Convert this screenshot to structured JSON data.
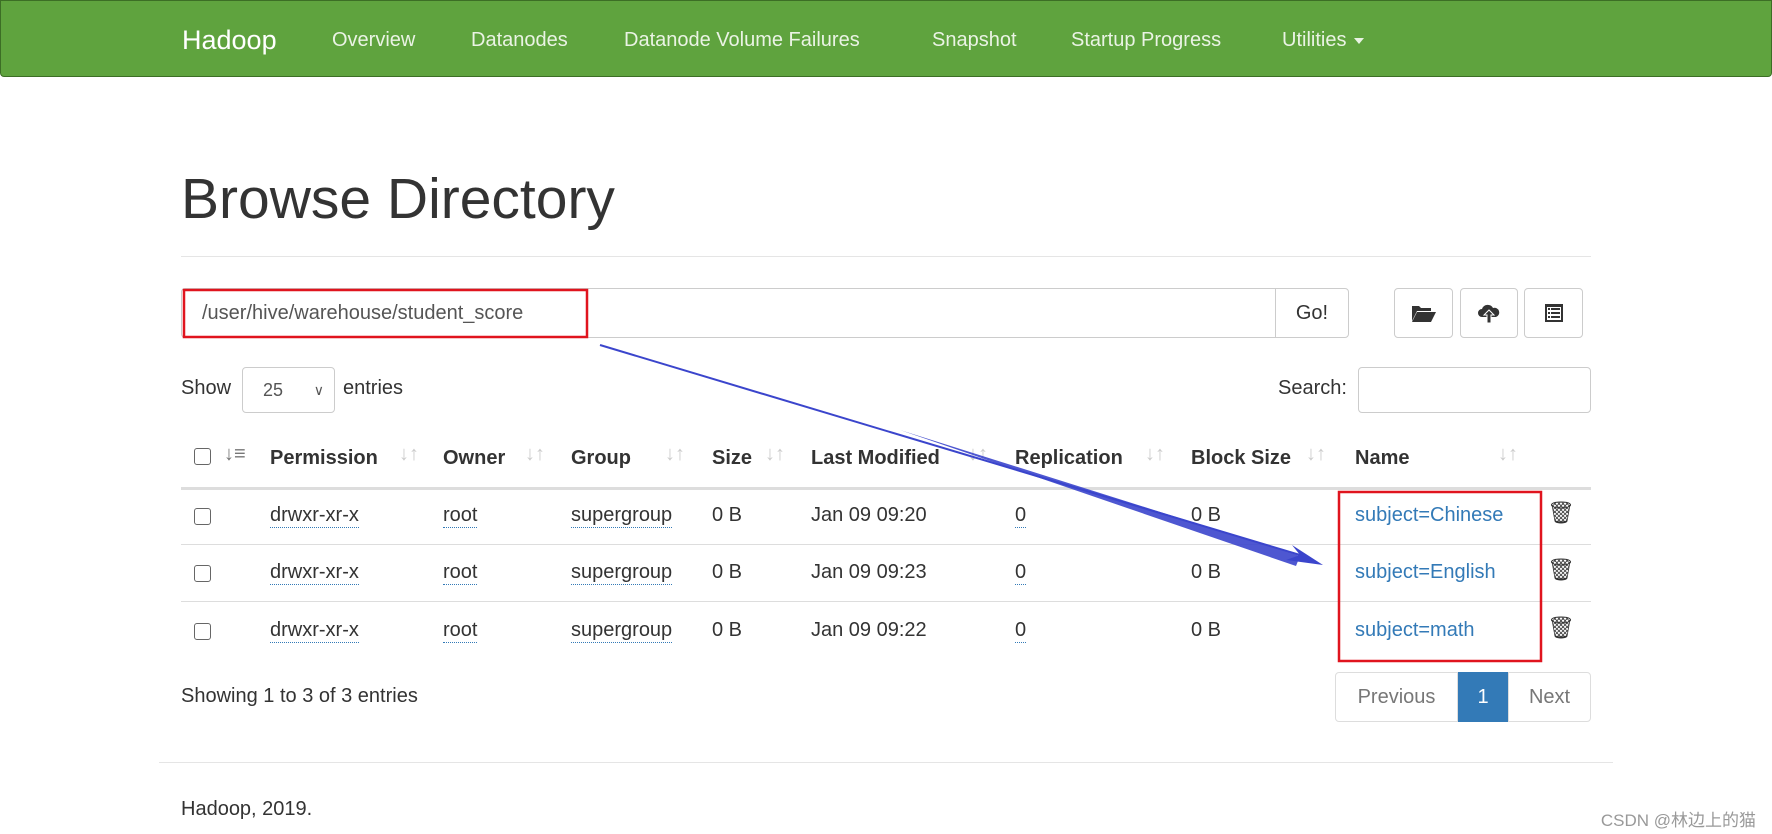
{
  "navbar": {
    "brand": "Hadoop",
    "items": [
      "Overview",
      "Datanodes",
      "Datanode Volume Failures",
      "Snapshot",
      "Startup Progress",
      "Utilities"
    ]
  },
  "page_title": "Browse Directory",
  "path_input": {
    "value": "/user/hive/warehouse/student_score"
  },
  "go_label": "Go!",
  "toolbar_icons": [
    "folder-open-icon",
    "cloud-upload-icon",
    "list-alt-icon"
  ],
  "show_label": "Show",
  "entries_value": "25",
  "entries_label": "entries",
  "search_label": "Search:",
  "table": {
    "headers": [
      "Permission",
      "Owner",
      "Group",
      "Size",
      "Last Modified",
      "Replication",
      "Block Size",
      "Name"
    ],
    "rows": [
      {
        "permission": "drwxr-xr-x",
        "owner": "root",
        "group": "supergroup",
        "size": "0 B",
        "modified": "Jan 09 09:20",
        "replication": "0",
        "block": "0 B",
        "name": "subject=Chinese"
      },
      {
        "permission": "drwxr-xr-x",
        "owner": "root",
        "group": "supergroup",
        "size": "0 B",
        "modified": "Jan 09 09:23",
        "replication": "0",
        "block": "0 B",
        "name": "subject=English"
      },
      {
        "permission": "drwxr-xr-x",
        "owner": "root",
        "group": "supergroup",
        "size": "0 B",
        "modified": "Jan 09 09:22",
        "replication": "0",
        "block": "0 B",
        "name": "subject=math"
      }
    ]
  },
  "showing_text": "Showing 1 to 3 of 3 entries",
  "pagination": {
    "previous": "Previous",
    "current": "1",
    "next": "Next"
  },
  "footer": "Hadoop, 2019.",
  "watermark": "CSDN @林边上的猫",
  "colors": {
    "navbar": "#5fa33e",
    "link": "#337ab7",
    "annotation_box": "#e0141e",
    "annotation_arrow": "#3b45cc"
  }
}
